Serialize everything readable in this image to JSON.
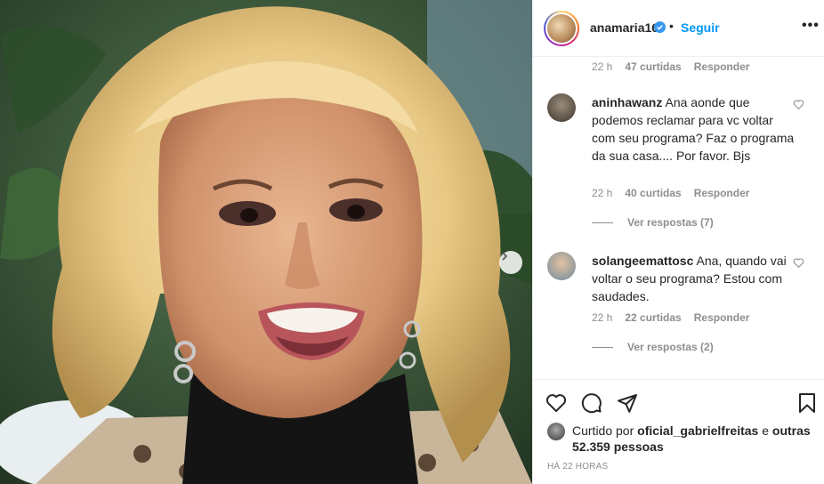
{
  "post": {
    "username": "anamaria16",
    "separator": "•",
    "follow_label": "Seguir",
    "more_label": "•••"
  },
  "comments": [
    {
      "time": "22 h",
      "likes": "47 curtidas",
      "reply": "Responder"
    },
    {
      "author": "aninhawanz",
      "text": "Ana aonde que podemos reclamar para vc voltar com seu programa? Faz o programa da sua casa.... Por favor. Bjs",
      "time": "22 h",
      "likes": "40 curtidas",
      "reply": "Responder",
      "view_replies": "Ver respostas (7)"
    },
    {
      "author": "solangeemattosc",
      "text": "Ana, quando vai voltar o seu programa? Estou com saudades.",
      "time": "22 h",
      "likes": "22 curtidas",
      "reply": "Responder",
      "view_replies": "Ver respostas (2)"
    }
  ],
  "likes": {
    "prefix": "Curtido por",
    "user": "oficial_gabrielfreitas",
    "conj": "e",
    "others": "outras 52.359 pessoas"
  },
  "timestamp": "HÁ 22 HORAS",
  "colors": {
    "link": "#0095f6",
    "muted": "#8e8e8e",
    "text": "#262626"
  },
  "icons": [
    "heart-icon",
    "comment-icon",
    "share-icon",
    "bookmark-icon",
    "verified-icon",
    "chevron-right-icon"
  ]
}
